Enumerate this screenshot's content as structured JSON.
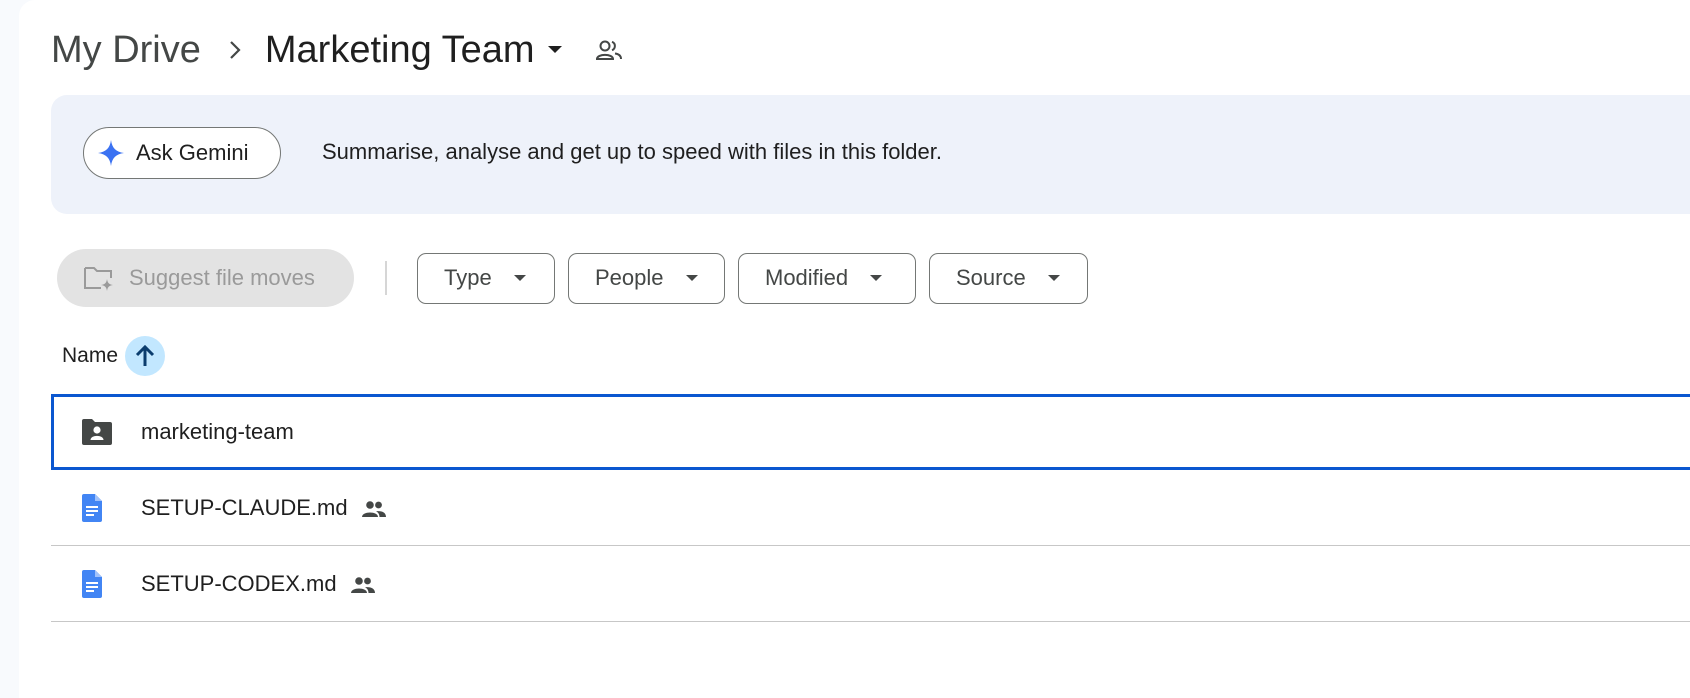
{
  "breadcrumb": {
    "root": "My Drive",
    "current": "Marketing Team"
  },
  "gemini": {
    "button_label": "Ask Gemini",
    "prompt": "Summarise, analyse and get up to speed with files in this folder."
  },
  "filters": {
    "suggest_label": "Suggest file moves",
    "chips": [
      {
        "label": "Type"
      },
      {
        "label": "People"
      },
      {
        "label": "Modified"
      },
      {
        "label": "Source"
      }
    ]
  },
  "columns": {
    "name": "Name",
    "sort": "ascending"
  },
  "files": [
    {
      "name": "marketing-team",
      "kind": "shared-folder",
      "icon": "shared-folder-icon",
      "shared": false,
      "selected": true
    },
    {
      "name": "SETUP-CLAUDE.md",
      "kind": "document",
      "icon": "document-icon",
      "shared": true,
      "selected": false
    },
    {
      "name": "SETUP-CODEX.md",
      "kind": "document",
      "icon": "document-icon",
      "shared": true,
      "selected": false
    }
  ],
  "colors": {
    "accent": "#0b57d0",
    "doc_blue": "#4285f4",
    "gemini_blue": "#3b72f2",
    "banner_bg": "#eef2fa",
    "sort_bg": "#c2e7ff"
  }
}
